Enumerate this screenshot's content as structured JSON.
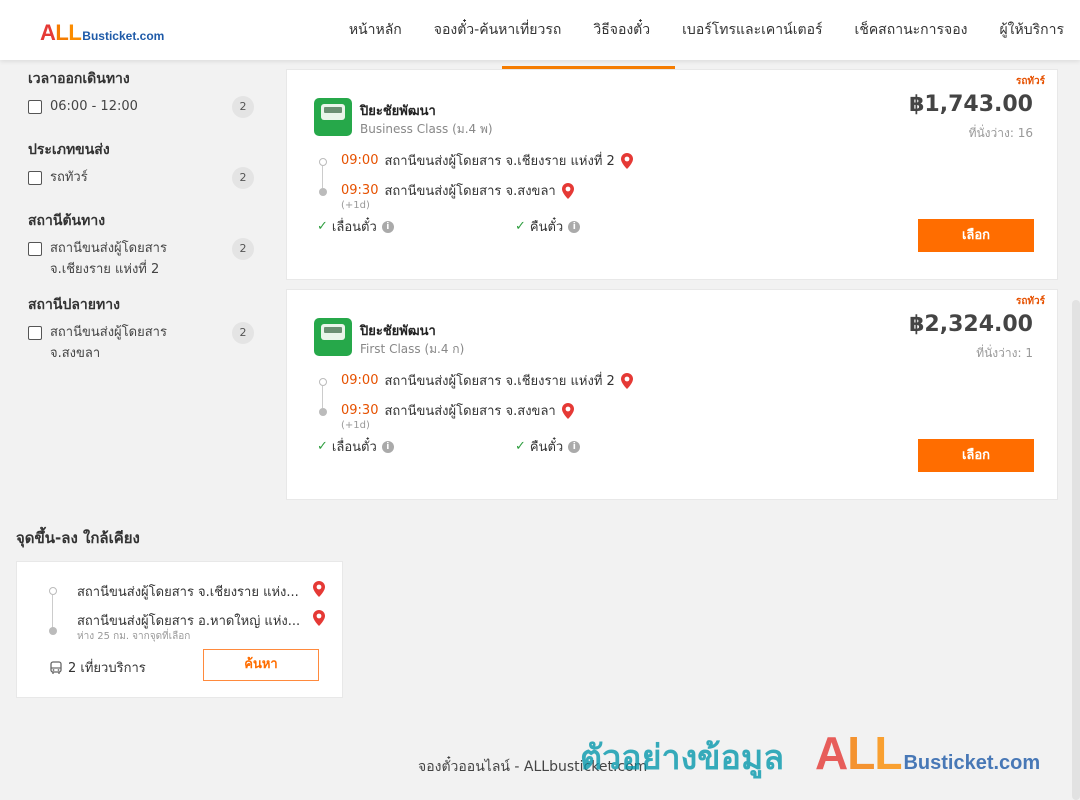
{
  "header": {
    "logo": {
      "all_a": "A",
      "all_l1": "L",
      "all_l2": "L",
      "rest": "Busticket.com"
    },
    "nav": [
      {
        "label": "หน้าหลัก"
      },
      {
        "label": "จองตั๋ว-ค้นหาเที่ยวรถ"
      },
      {
        "label": "วิธีจองตั๋ว"
      },
      {
        "label": "เบอร์โทรและเคาน์เตอร์"
      },
      {
        "label": "เช็คสถานะการจอง"
      },
      {
        "label": "ผู้ให้บริการ"
      }
    ],
    "active_nav": "วิธีจองตั๋ว"
  },
  "filters": [
    {
      "title": "เวลาออกเดินทาง",
      "options": [
        {
          "label": "06:00 - 12:00",
          "count": "2"
        }
      ]
    },
    {
      "title": "ประเภทขนส่ง",
      "options": [
        {
          "label": "รถทัวร์",
          "count": "2"
        }
      ]
    },
    {
      "title": "สถานีต้นทาง",
      "options": [
        {
          "label": "สถานีขนส่งผู้โดยสาร จ.เชียงราย แห่งที่ 2",
          "count": "2"
        }
      ]
    },
    {
      "title": "สถานีปลายทาง",
      "options": [
        {
          "label": "สถานีขนส่งผู้โดยสาร จ.สงขลา",
          "count": "2"
        }
      ]
    }
  ],
  "trips": [
    {
      "tag": "รถทัวร์",
      "operator": "ปิยะชัยพัฒนา",
      "class": "Business Class (ม.4 พ)",
      "price": "฿1,743.00",
      "seats": "ที่นั่งว่าง: 16",
      "depart_time": "09:00",
      "depart_place": "สถานีขนส่งผู้โดยสาร จ.เชียงราย แห่งที่ 2",
      "arrive_time": "09:30",
      "arrive_place": "สถานีขนส่งผู้โดยสาร จ.สงขลา",
      "next_day": "(+1d)",
      "feature1": "เลื่อนตั๋ว",
      "feature2": "คืนตั๋ว",
      "button": "เลือก"
    },
    {
      "tag": "รถทัวร์",
      "operator": "ปิยะชัยพัฒนา",
      "class": "First Class (ม.4 ก)",
      "price": "฿2,324.00",
      "seats": "ที่นั่งว่าง: 1",
      "depart_time": "09:00",
      "depart_place": "สถานีขนส่งผู้โดยสาร จ.เชียงราย แห่งที่ 2",
      "arrive_time": "09:30",
      "arrive_place": "สถานีขนส่งผู้โดยสาร จ.สงขลา",
      "next_day": "(+1d)",
      "feature1": "เลื่อนตั๋ว",
      "feature2": "คืนตั๋ว",
      "button": "เลือก"
    }
  ],
  "nearby": {
    "title": "จุดขึ้น-ลง ใกล้เคียง",
    "from": "สถานีขนส่งผู้โดยสาร จ.เชียงราย แห่ง...",
    "to": "สถานีขนส่งผู้โดยสาร อ.หาดใหญ่ แห่ง...",
    "distance": "ห่าง 25 กม. จากจุดที่เลือก",
    "trips": "2 เที่ยวบริการ",
    "button": "ค้นหา"
  },
  "footer": {
    "text": "จองตั๋วออนไลน์ - ALLbusticket.com",
    "watermark": "ตัวอย่างข้อมูล",
    "watermark_logo": {
      "all_a": "A",
      "all_l1": "L",
      "all_l2": "L",
      "rest": "Busticket.com"
    }
  },
  "colors": {
    "accent": "#ff6d00",
    "time": "#e65100",
    "check": "#2e9e3f",
    "watermark": "#0096aa"
  },
  "icons": {
    "pin": "map-pin-icon",
    "check": "check-icon",
    "info": "info-icon",
    "bus": "bus-icon"
  }
}
